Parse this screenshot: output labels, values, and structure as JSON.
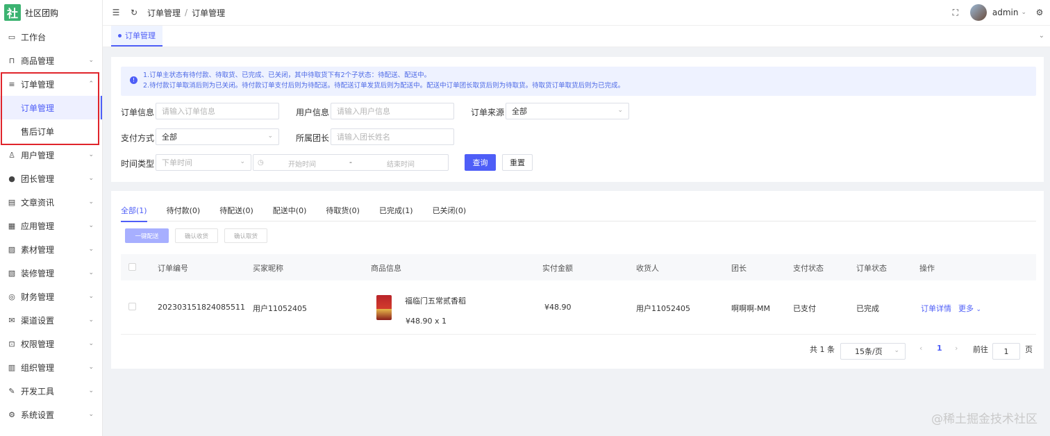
{
  "app": {
    "logo_char": "社",
    "name": "社区团购"
  },
  "sidebar": {
    "items": [
      {
        "label": "工作台",
        "icon": "monitor-icon",
        "glyph": "▭",
        "chev": ""
      },
      {
        "label": "商品管理",
        "icon": "bag-icon",
        "glyph": "⊓",
        "chev": "⌄"
      },
      {
        "label": "订单管理",
        "icon": "list-icon",
        "glyph": "≡",
        "chev": "⌃"
      },
      {
        "label": "用户管理",
        "icon": "user-icon",
        "glyph": "♙",
        "chev": "⌄"
      },
      {
        "label": "团长管理",
        "icon": "person-icon",
        "glyph": "●",
        "chev": "⌄"
      },
      {
        "label": "文章资讯",
        "icon": "message-icon",
        "glyph": "▤",
        "chev": "⌄"
      },
      {
        "label": "应用管理",
        "icon": "apps-icon",
        "glyph": "▦",
        "chev": "⌄"
      },
      {
        "label": "素材管理",
        "icon": "picture-icon",
        "glyph": "▨",
        "chev": "⌄"
      },
      {
        "label": "装修管理",
        "icon": "brush-icon",
        "glyph": "▧",
        "chev": "⌄"
      },
      {
        "label": "财务管理",
        "icon": "money-icon",
        "glyph": "◎",
        "chev": "⌄"
      },
      {
        "label": "渠道设置",
        "icon": "mail-icon",
        "glyph": "✉",
        "chev": "⌄"
      },
      {
        "label": "权限管理",
        "icon": "lock-icon",
        "glyph": "⊡",
        "chev": "⌄"
      },
      {
        "label": "组织管理",
        "icon": "building-icon",
        "glyph": "▥",
        "chev": "⌄"
      },
      {
        "label": "开发工具",
        "icon": "pen-icon",
        "glyph": "✎",
        "chev": "⌄"
      },
      {
        "label": "系统设置",
        "icon": "gear-icon",
        "glyph": "⚙",
        "chev": "⌄"
      }
    ],
    "submenu": [
      {
        "label": "订单管理",
        "active": true
      },
      {
        "label": "售后订单",
        "active": false
      }
    ]
  },
  "header": {
    "breadcrumb": [
      "订单管理",
      "订单管理"
    ],
    "breadcrumb_sep": "/",
    "username": "admin"
  },
  "page_tab": {
    "label": "订单管理"
  },
  "alert": {
    "line1": "1.订单主状态有待付款、待取货、已完成、已关闭，其中待取货下有2个子状态：待配送、配送中。",
    "line2": "2.待付款订单取消后则为已关闭。待付款订单支付后则为待配送。待配送订单发货后则为配送中。配送中订单团长取货后则为待取货。待取货订单取货后则为已完成。"
  },
  "filters": {
    "order_info": {
      "label": "订单信息",
      "placeholder": "请输入订单信息"
    },
    "user_info": {
      "label": "用户信息",
      "placeholder": "请输入用户信息"
    },
    "order_source": {
      "label": "订单来源",
      "value": "全部"
    },
    "pay_method": {
      "label": "支付方式",
      "value": "全部"
    },
    "leader": {
      "label": "所属团长",
      "placeholder": "请输入团长姓名"
    },
    "time_type": {
      "label": "时间类型",
      "value": "下单时间"
    },
    "date_range": {
      "start": "开始时间",
      "sep": "-",
      "end": "结束时间"
    },
    "search_btn": "查询",
    "reset_btn": "重置"
  },
  "status_tabs": [
    "全部(1)",
    "待付款(0)",
    "待配送(0)",
    "配送中(0)",
    "待取货(0)",
    "已完成(1)",
    "已关闭(0)"
  ],
  "batch_actions": [
    "一键配送",
    "确认收货",
    "确认取货"
  ],
  "table": {
    "columns": [
      "订单编号",
      "买家昵称",
      "商品信息",
      "实付金额",
      "收货人",
      "团长",
      "支付状态",
      "订单状态",
      "操作"
    ],
    "rows": [
      {
        "order_no": "20230315182408551​1",
        "buyer": "用户11052405",
        "product_name": "福临门五常贰香稻",
        "product_price": "¥48.90 x 1",
        "paid": "¥48.90",
        "receiver": "用户11052405",
        "leader": "啊啊啊-MM",
        "pay_status": "已支付",
        "order_status": "已完成",
        "action_detail": "订单详情",
        "action_more": "更多"
      }
    ]
  },
  "pagination": {
    "total": "共 1 条",
    "page_size": "15条/页",
    "prev": "‹",
    "current": "1",
    "next": "›",
    "goto_label": "前往",
    "goto_value": "1",
    "page_suffix": "页"
  },
  "watermark": "@稀土掘金技术社区",
  "colors": {
    "accent": "#4e5ef7",
    "highlight": "#e0242b"
  }
}
